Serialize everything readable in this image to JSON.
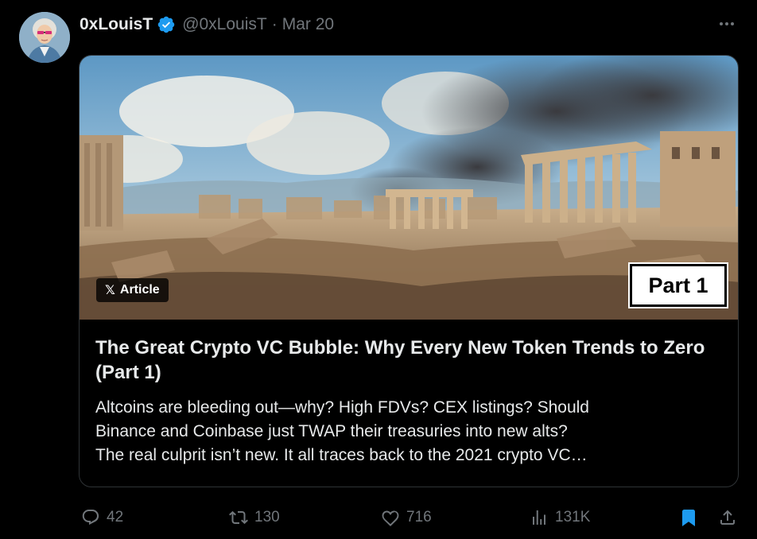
{
  "tweet": {
    "display_name": "0xLouisT",
    "handle": "@0xLouisT",
    "separator": "·",
    "date": "Mar 20"
  },
  "article": {
    "badge_logo": "𝕏",
    "badge_label": "Article",
    "part_label": "Part 1",
    "title": "The Great Crypto VC Bubble: Why Every New Token Trends to Zero (Part 1)",
    "description_lines": [
      "Altcoins are bleeding out—why? High FDVs? CEX listings? Should",
      "Binance and Coinbase just TWAP their treasuries into new alts?",
      "The real culprit isn’t new. It all traces back to the 2021 crypto VC…"
    ]
  },
  "actions": {
    "replies": "42",
    "reposts": "130",
    "likes": "716",
    "views": "131K"
  },
  "colors": {
    "background": "#000000",
    "text_primary": "#e7e9ea",
    "text_secondary": "#71767b",
    "verified_blue": "#1d9bf0",
    "border": "#2f3336"
  },
  "icons": [
    "avatar",
    "verified-badge-icon",
    "more-icon",
    "reply-icon",
    "repost-icon",
    "like-icon",
    "views-icon",
    "bookmark-icon",
    "share-icon"
  ]
}
